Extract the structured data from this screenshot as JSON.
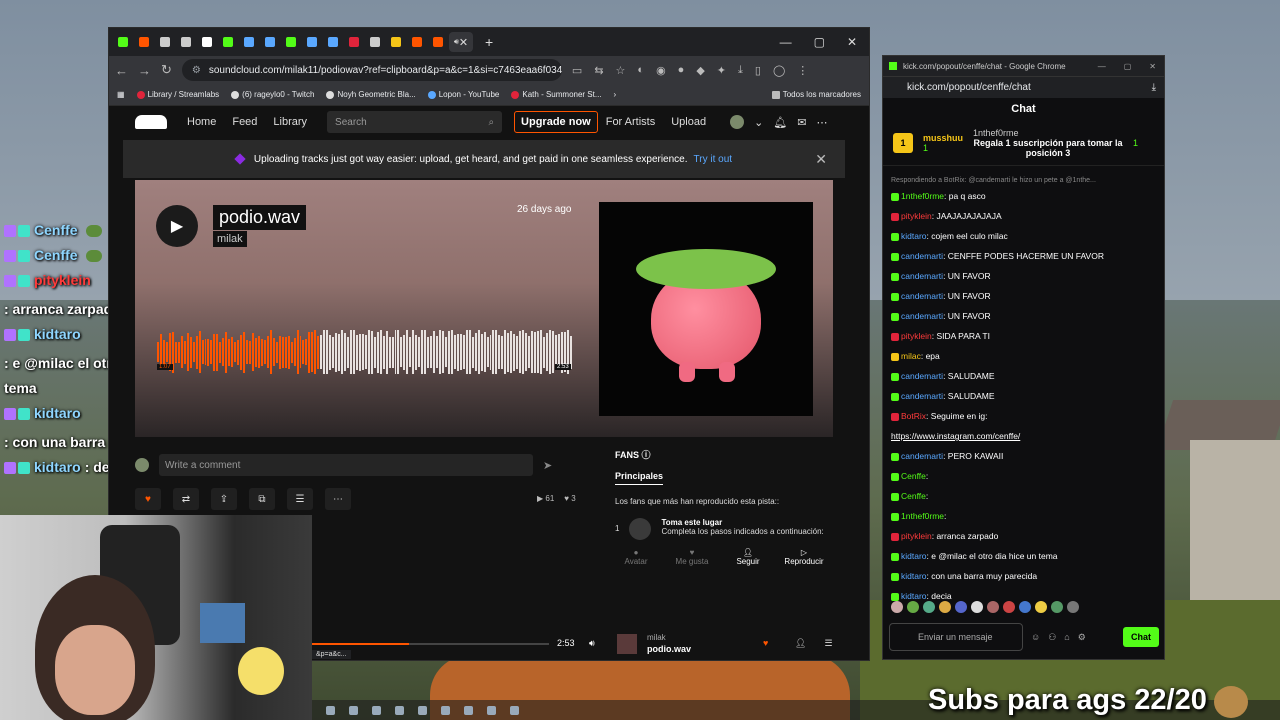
{
  "overlay_chat": [
    {
      "user": "Cenffe",
      "text": "",
      "red": false
    },
    {
      "user": "Cenffe",
      "text": "",
      "red": false
    },
    {
      "user": "pityklein",
      "text": ": arranca zarpado",
      "red": true
    },
    {
      "user": "kidtaro",
      "text": ": e @milac el otro dia hice un tema",
      "red": false
    },
    {
      "user": "kidtaro",
      "text": ": con una barra muy parecida",
      "red": false
    },
    {
      "user": "kidtaro",
      "text": ": decia",
      "red": false
    }
  ],
  "browser": {
    "tab_labels": [
      "Ce",
      "St",
      "dc",
      "dc",
      "(3",
      "",
      "",
      "",
      "",
      "",
      "",
      "Di",
      "Yc",
      "Di",
      "St",
      "St"
    ],
    "url": "soundcloud.com/milak11/podiowav?ref=clipboard&p=a&c=1&si=c7463eaa6f0348...",
    "bookmarks": [
      "Library / Streamlabs",
      "(6) rageylo0 - Twitch",
      "Noyh Geometric Bla...",
      "Lopon - YouTube",
      "Kath - Summoner St..."
    ],
    "bookmarks_right": "Todos los marcadores"
  },
  "soundcloud": {
    "nav": [
      "Home",
      "Feed",
      "Library"
    ],
    "search_placeholder": "Search",
    "upgrade": "Upgrade now",
    "for_artists": "For Artists",
    "upload": "Upload",
    "banner_text": "Uploading tracks just got way easier: upload, get heard, and get paid in one seamless experience.",
    "banner_link": "Try it out",
    "track": {
      "title": "podio.wav",
      "artist": "milak",
      "ago": "26 days ago",
      "time_played": "1:07",
      "duration": "2:53",
      "progress": 0.39
    },
    "comment_placeholder": "Write a comment",
    "plays": "61",
    "likes": "3",
    "fans": {
      "heading": "FANS",
      "tab": "Principales",
      "desc": "Los fans que más han reproducido esta pista::",
      "rank": "1",
      "take_place": "Toma este lugar",
      "steps": "Completa los pasos indicados a continuación:",
      "buttons": [
        "Avatar",
        "Me gusta",
        "Seguir",
        "Reproducir"
      ]
    },
    "player": {
      "time": "2:53",
      "artist": "milak",
      "track": "podio.wav"
    },
    "cam_tooltip": "&p=a&c..."
  },
  "kick": {
    "window_title": "kick.com/popout/cenffe/chat - Google Chrome",
    "url": "kick.com/popout/cenffe/chat",
    "header": "Chat",
    "pin_user": "musshuu",
    "pin_badge": "1",
    "pin_user2": "1nthef0rme",
    "pin_gift": "Regala 1 suscripción para tomar la posición 3",
    "reply_note": "Respondiendo a BotRix: @candemarti le hizo un pete a @1nthe...",
    "messages": [
      {
        "user": "1nthef0rme",
        "text": ": pa q asco",
        "color": "green"
      },
      {
        "user": "pityklein",
        "text": ": JAAJAJAJAJAJA",
        "color": "red"
      },
      {
        "user": "kidtaro",
        "text": ": cojem eel culo milac",
        "color": "blue"
      },
      {
        "user": "candemarti",
        "text": ": CENFFE PODES HACERME UN FAVOR",
        "color": "blue"
      },
      {
        "user": "candemarti",
        "text": ": UN FAVOR",
        "color": "blue"
      },
      {
        "user": "candemarti",
        "text": ": UN FAVOR",
        "color": "blue"
      },
      {
        "user": "candemarti",
        "text": ": UN FAVOR",
        "color": "blue"
      },
      {
        "user": "pityklein",
        "text": ": SIDA PARA TI",
        "color": "red"
      },
      {
        "user": "milac",
        "text": ": epa",
        "color": "yellow"
      },
      {
        "user": "candemarti",
        "text": ": SALUDAME",
        "color": "blue"
      },
      {
        "user": "candemarti",
        "text": ": SALUDAME",
        "color": "blue"
      },
      {
        "user": "BotRix",
        "text": ": Seguime en ig:",
        "color": "red"
      },
      {
        "user": "",
        "text": "https://www.instagram.com/cenffe/",
        "color": "link"
      },
      {
        "user": "candemarti",
        "text": ": PERO KAWAII",
        "color": "blue"
      },
      {
        "user": "Cenffe",
        "text": ":",
        "color": "green"
      },
      {
        "user": "Cenffe",
        "text": ":",
        "color": "green"
      },
      {
        "user": "1nthef0rme",
        "text": ":",
        "color": "green"
      },
      {
        "user": "pityklein",
        "text": ": arranca zarpado",
        "color": "red"
      },
      {
        "user": "kidtaro",
        "text": ": e @milac el otro dia hice un tema",
        "color": "blue"
      },
      {
        "user": "kidtaro",
        "text": ": con una barra muy parecida",
        "color": "blue"
      },
      {
        "user": "kidtaro",
        "text": ": decia",
        "color": "blue"
      }
    ],
    "input_placeholder": "Enviar un mensaje",
    "chat_button": "Chat"
  },
  "subs_text": "Subs para ags 22/20",
  "colors": {
    "soundcloud": "#ff5500",
    "kick": "#53fc18"
  }
}
